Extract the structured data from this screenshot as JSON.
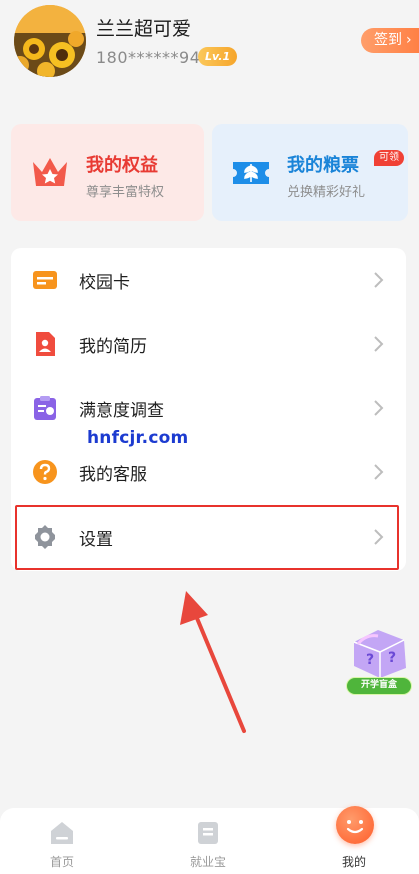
{
  "profile": {
    "username": "兰兰超可爱",
    "phone": "180******94",
    "level": "Lv.1",
    "signin_label": "签到",
    "signin_chevron": "›"
  },
  "cards": {
    "rights": {
      "title": "我的权益",
      "subtitle": "尊享丰富特权",
      "icon": "crown-icon",
      "color": "#e83b34"
    },
    "tickets": {
      "title": "我的粮票",
      "subtitle": "兑换精彩好礼",
      "badge": "可领",
      "icon": "ticket-icon",
      "color": "#1a84d8"
    }
  },
  "menu": {
    "items": [
      {
        "label": "校园卡",
        "icon": "campus-card-icon"
      },
      {
        "label": "我的简历",
        "icon": "resume-icon"
      },
      {
        "label": "满意度调查",
        "icon": "survey-icon"
      },
      {
        "label": "我的客服",
        "icon": "help-icon"
      },
      {
        "label": "设置",
        "icon": "gear-icon"
      }
    ]
  },
  "watermark": "hnfcjr.com",
  "floating": {
    "label": "开学盲盒"
  },
  "tabbar": {
    "tabs": [
      {
        "label": "首页",
        "icon": "home-icon",
        "active": false
      },
      {
        "label": "就业宝",
        "icon": "jobs-icon",
        "active": false
      },
      {
        "label": "我的",
        "icon": "mine-icon",
        "active": true
      }
    ]
  },
  "colors": {
    "accent": "#ff7a3d",
    "highlight": "#e8322c",
    "page_bg": "#f4f4f4"
  }
}
